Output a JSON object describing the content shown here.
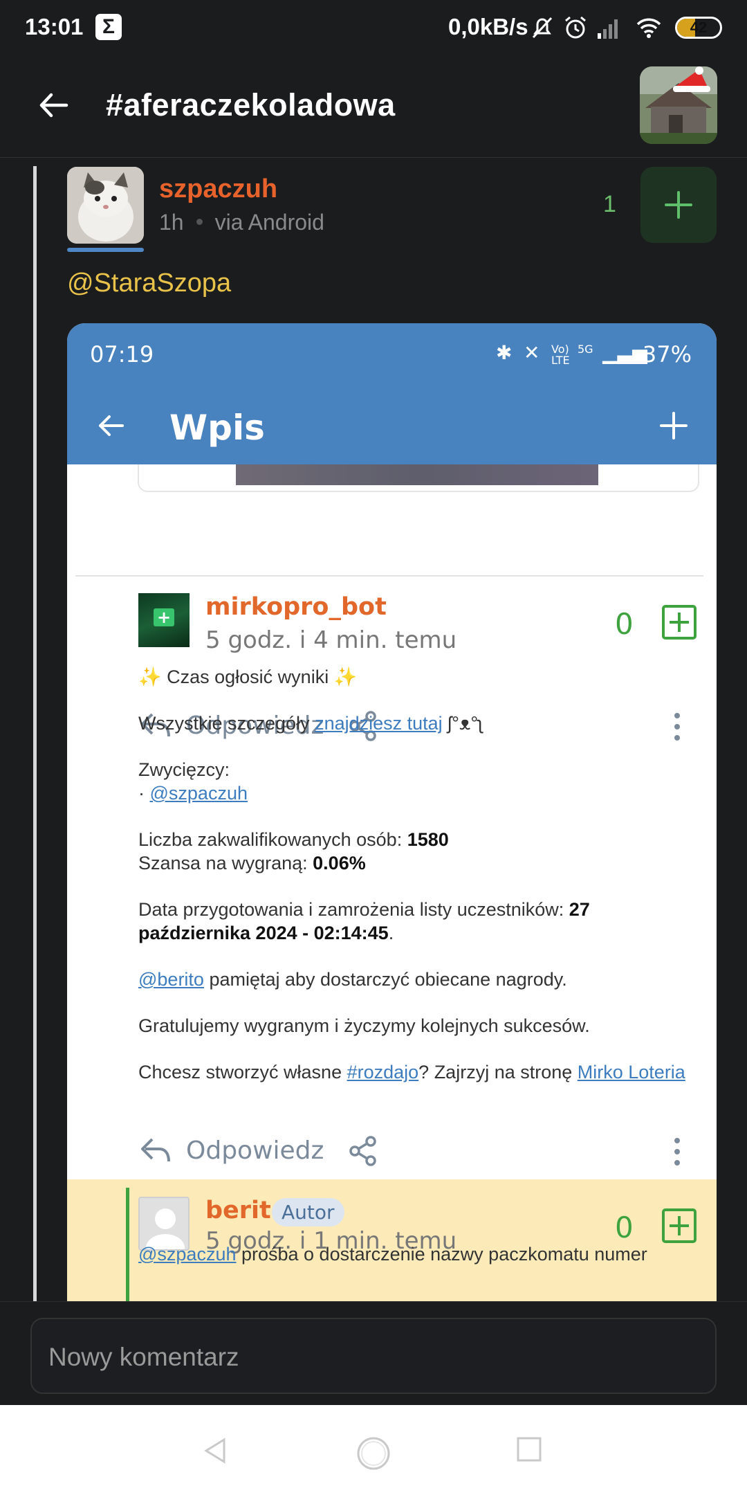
{
  "status_bar": {
    "time": "13:01",
    "app_icon": "Σ",
    "net_speed": "0,0kB/s",
    "battery": "42",
    "battery_level": 0.42,
    "icons": [
      "muted-bell-icon",
      "alarm-icon",
      "signal-icon",
      "wifi-icon",
      "battery-icon"
    ]
  },
  "app_bar": {
    "title": "#aferaczekoladowa"
  },
  "comment": {
    "author": "szpaczuh",
    "time": "1h",
    "via": "via Android",
    "votes": "1",
    "mention": "@StaraSzopa"
  },
  "embedded": {
    "status_time": "07:19",
    "battery": "37%",
    "title": "Wpis",
    "reply_label": "Odpowiedz",
    "post": {
      "author": "mirkopro_bot",
      "time": "5 godz. i 4 min. temu",
      "votes": "0",
      "line1": "✨ Czas ogłosić wyniki ✨",
      "details_prefix": "Wszystkie szczegóły ",
      "details_link": "znajdziesz tutaj",
      "details_suffix": " ʃ°ᴥ°ʅ",
      "winners_label": "Zwycięzcy:",
      "winner_bullet": "· ",
      "winner": "@szpaczuh",
      "qualified_label": "Liczba zakwalifikowanych osób: ",
      "qualified_value": "1580",
      "chance_label": "Szansa na wygraną: ",
      "chance_value": "0.06%",
      "date_label": "Data przygotowania i zamrożenia listy uczestników: ",
      "date_value": "27 października 2024 - 02:14:45",
      "date_suffix": ".",
      "berito_link": "@berito",
      "berito_text": " pamiętaj aby dostarczyć obiecane nagrody.",
      "congrats": "Gratulujemy wygranym i życzymy kolejnych sukcesów.",
      "create_prefix": "Chcesz stworzyć własne ",
      "create_tag": "#rozdajo",
      "create_mid": "? Zajrzyj na stronę ",
      "create_link": "Mirko Loteria"
    },
    "reply": {
      "author": "berito",
      "badge": "Autor",
      "time": "5 godz. i 1 min. temu",
      "votes": "0",
      "mention": "@szpaczuh",
      "text": " prośba o dostarczenie nazwy paczkomatu numer"
    }
  },
  "input": {
    "placeholder": "Nowy komentarz"
  }
}
